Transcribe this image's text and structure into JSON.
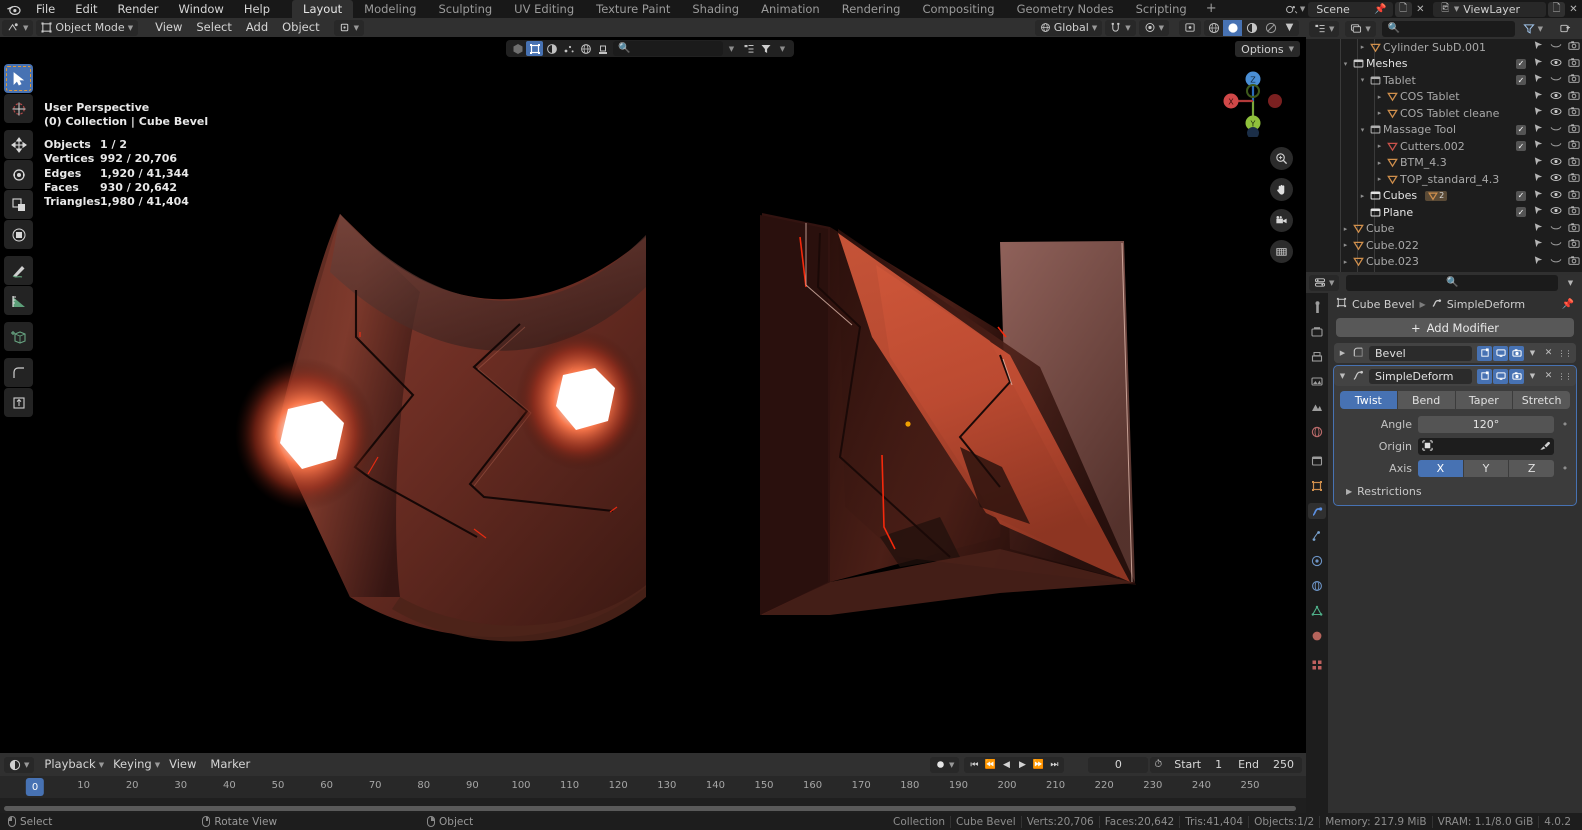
{
  "app": {
    "menus": [
      "File",
      "Edit",
      "Render",
      "Window",
      "Help"
    ],
    "workspace_tabs": [
      {
        "label": "Layout",
        "active": true
      },
      {
        "label": "Modeling",
        "active": false
      },
      {
        "label": "Sculpting",
        "active": false
      },
      {
        "label": "UV Editing",
        "active": false
      },
      {
        "label": "Texture Paint",
        "active": false
      },
      {
        "label": "Shading",
        "active": false
      },
      {
        "label": "Animation",
        "active": false
      },
      {
        "label": "Rendering",
        "active": false
      },
      {
        "label": "Compositing",
        "active": false
      },
      {
        "label": "Geometry Nodes",
        "active": false
      },
      {
        "label": "Scripting",
        "active": false
      }
    ],
    "add_tab_label": "+",
    "scene_name": "Scene",
    "viewlayer_name": "ViewLayer"
  },
  "view3d_header": {
    "mode": "Object Mode",
    "menus": [
      "View",
      "Select",
      "Add",
      "Object"
    ],
    "transform_orientation": "Global",
    "options_label": "Options"
  },
  "viewport": {
    "overlay": {
      "perspective": "User Perspective",
      "collection_line": "(0) Collection | Cube Bevel",
      "stats": [
        {
          "key": "Objects",
          "value": "1 / 2"
        },
        {
          "key": "Vertices",
          "value": "992 / 20,706"
        },
        {
          "key": "Edges",
          "value": "1,920 / 41,344"
        },
        {
          "key": "Faces",
          "value": "930 / 20,642"
        },
        {
          "key": "Triangles",
          "value": "1,980 / 41,404"
        }
      ]
    },
    "gizmo_axes": [
      "Z",
      "Y",
      "X"
    ],
    "tools": [
      "tweak-select-tool",
      "cursor-tool",
      "move-tool",
      "rotate-tool",
      "scale-tool",
      "transform-tool",
      "annotate-tool",
      "measure-tool",
      "add-cube-tool",
      "bevel-tool",
      "extrude-tool"
    ]
  },
  "outliner": {
    "search_placeholder": "",
    "rows": [
      {
        "indent": 3,
        "tri": "▸",
        "icon": "mesh-data-icon",
        "icon_color": "#d08f4c",
        "name": "Cylinder SubD.001",
        "dim": true,
        "checkbox": false,
        "eye": "closed"
      },
      {
        "indent": 2,
        "tri": "▾",
        "icon": "collection-icon",
        "icon_color": "#c9c9c9",
        "name": "Meshes",
        "dim": false,
        "checkbox": true,
        "eye": "open"
      },
      {
        "indent": 3,
        "tri": "▾",
        "icon": "collection-icon",
        "icon_color": "#b0b0b0",
        "name": "Tablet",
        "dim": true,
        "checkbox": true,
        "eye": "closed"
      },
      {
        "indent": 4,
        "tri": "▸",
        "icon": "mesh-data-icon",
        "icon_color": "#d08f4c",
        "name": "COS Tablet",
        "dim": true,
        "checkbox": false,
        "eye": "open"
      },
      {
        "indent": 4,
        "tri": "▸",
        "icon": "mesh-data-icon",
        "icon_color": "#d08f4c",
        "name": "COS Tablet cleane",
        "dim": true,
        "checkbox": false,
        "eye": "open"
      },
      {
        "indent": 3,
        "tri": "▾",
        "icon": "collection-icon",
        "icon_color": "#b0b0b0",
        "name": "Massage Tool",
        "dim": true,
        "checkbox": true,
        "eye": "closed"
      },
      {
        "indent": 4,
        "tri": "▸",
        "icon": "mesh-data-icon",
        "icon_color": "#c9524a",
        "name": "Cutters.002",
        "dim": true,
        "checkbox": true,
        "eye": "closed"
      },
      {
        "indent": 4,
        "tri": "▸",
        "icon": "mesh-data-icon",
        "icon_color": "#d08f4c",
        "name": "BTM_4.3",
        "dim": true,
        "checkbox": false,
        "eye": "open"
      },
      {
        "indent": 4,
        "tri": "▸",
        "icon": "mesh-data-icon",
        "icon_color": "#d08f4c",
        "name": "TOP_standard_4.3",
        "dim": true,
        "checkbox": false,
        "eye": "open"
      },
      {
        "indent": 3,
        "tri": "▸",
        "icon": "collection-icon",
        "icon_color": "#e2e2e2",
        "name": "Cubes",
        "dim": false,
        "checkbox": true,
        "eye": "open",
        "badge": "2"
      },
      {
        "indent": 3,
        "tri": "",
        "icon": "collection-icon",
        "icon_color": "#e2e2e2",
        "name": "Plane",
        "dim": false,
        "checkbox": true,
        "eye": "open"
      },
      {
        "indent": 2,
        "tri": "▸",
        "icon": "mesh-data-icon",
        "icon_color": "#d08f4c",
        "name": "Cube",
        "dim": true,
        "checkbox": false,
        "eye": "closed"
      },
      {
        "indent": 2,
        "tri": "▸",
        "icon": "mesh-data-icon",
        "icon_color": "#d08f4c",
        "name": "Cube.022",
        "dim": true,
        "checkbox": false,
        "eye": "closed"
      },
      {
        "indent": 2,
        "tri": "▸",
        "icon": "mesh-data-icon",
        "icon_color": "#d08f4c",
        "name": "Cube.023",
        "dim": true,
        "checkbox": false,
        "eye": "closed"
      }
    ]
  },
  "properties": {
    "search_placeholder": "",
    "breadcrumb": {
      "object": "Cube Bevel",
      "modifier": "SimpleDeform"
    },
    "add_modifier_label": "Add Modifier",
    "modifiers": [
      {
        "name": "Bevel",
        "expanded": false,
        "active": false
      },
      {
        "name": "SimpleDeform",
        "expanded": true,
        "active": true
      }
    ],
    "simple_deform": {
      "mode_options": [
        "Twist",
        "Bend",
        "Taper",
        "Stretch"
      ],
      "mode_selected": "Twist",
      "angle_label": "Angle",
      "angle_value": "120°",
      "origin_label": "Origin",
      "origin_value": "",
      "axis_label": "Axis",
      "axis_options": [
        "X",
        "Y",
        "Z"
      ],
      "axis_selected": "X",
      "restrictions_label": "Restrictions"
    }
  },
  "timeline": {
    "menus": [
      "Playback",
      "Keying",
      "View",
      "Marker"
    ],
    "current_frame": "0",
    "start_label": "Start",
    "start_value": "1",
    "end_label": "End",
    "end_value": "250",
    "ticks": [
      "10",
      "20",
      "30",
      "40",
      "50",
      "60",
      "70",
      "80",
      "90",
      "100",
      "110",
      "120",
      "130",
      "140",
      "150",
      "160",
      "170",
      "180",
      "190",
      "200",
      "210",
      "220",
      "230",
      "240",
      "250"
    ],
    "playhead_label": "0"
  },
  "statusbar": {
    "left": [
      {
        "mouse": "left",
        "label": "Select"
      },
      {
        "mouse": "middle",
        "label": "Rotate View"
      },
      {
        "mouse": "right",
        "label": "Object"
      }
    ],
    "right": [
      "Collection",
      "Cube Bevel",
      "Verts:20,706",
      "Faces:20,642",
      "Tris:41,404",
      "Objects:1/2",
      "Memory: 217.9 MiB",
      "VRAM: 1.1/8.0 GiB",
      "4.0.2"
    ]
  },
  "colors": {
    "accent": "#4772b3",
    "header_bg": "#303030",
    "panel_bg": "#1d1d1d",
    "viewport_bg": "#000000",
    "mesh_orange": "#d08f4c",
    "model_red": "#b24232"
  }
}
